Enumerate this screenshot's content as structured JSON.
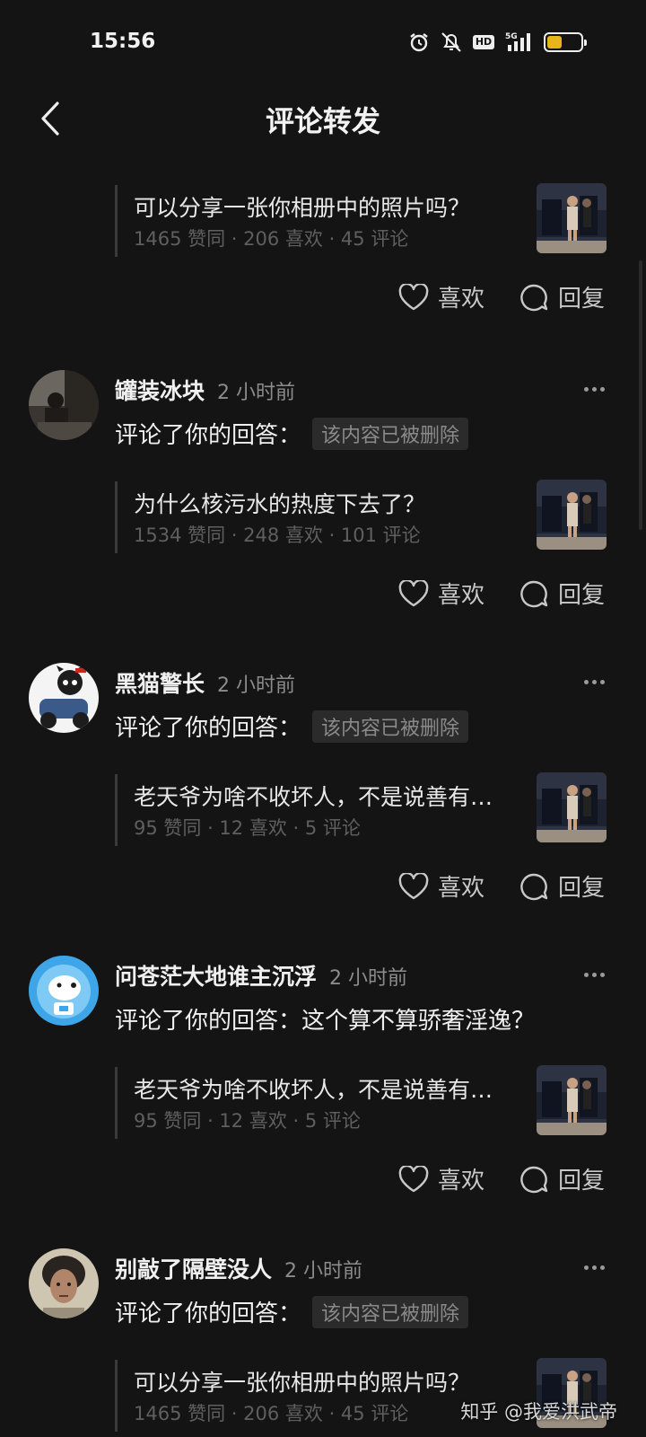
{
  "status_bar": {
    "time": "15:56",
    "hd": "HD",
    "network": "5G",
    "battery_level": 0.45,
    "battery_color": "#e7b41a"
  },
  "nav": {
    "title": "评论转发",
    "back_icon": "chevron-left-icon"
  },
  "feed": [
    {
      "partial": true,
      "quote_title": "可以分享一张你相册中的照片吗？",
      "quote_stats": "1465 赞同 · 206 喜欢 · 45 评论",
      "like_label": "喜欢",
      "reply_label": "回复"
    },
    {
      "user": "罐装冰块",
      "time": "2 小时前",
      "action": "评论了你的回答：",
      "deleted_note": "该内容已被删除",
      "quote_title": "为什么核污水的热度下去了？",
      "quote_stats": "1534 赞同 · 248 喜欢 · 101 评论",
      "like_label": "喜欢",
      "reply_label": "回复"
    },
    {
      "user": "黑猫警长",
      "time": "2 小时前",
      "action": "评论了你的回答：",
      "deleted_note": "该内容已被删除",
      "quote_title": "老天爷为啥不收坏人，不是说善有…",
      "quote_stats": "95 赞同 · 12 喜欢 · 5 评论",
      "like_label": "喜欢",
      "reply_label": "回复"
    },
    {
      "user": "问苍茫大地谁主沉浮",
      "time": "2 小时前",
      "action": "评论了你的回答：这个算不算骄奢淫逸？",
      "quote_title": "老天爷为啥不收坏人，不是说善有…",
      "quote_stats": "95 赞同 · 12 喜欢 · 5 评论",
      "like_label": "喜欢",
      "reply_label": "回复"
    },
    {
      "user": "别敲了隔壁没人",
      "time": "2 小时前",
      "action": "评论了你的回答：",
      "deleted_note": "该内容已被删除",
      "quote_title": "可以分享一张你相册中的照片吗？",
      "quote_stats": "1465 赞同 · 206 喜欢 · 45 评论"
    }
  ],
  "watermark": "知乎 @我爱洪武帝"
}
